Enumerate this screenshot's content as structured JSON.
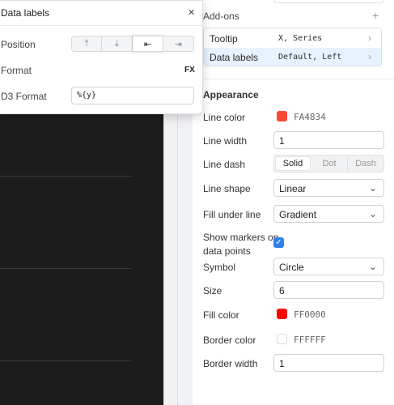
{
  "popup": {
    "title": "Data labels",
    "close_icon": "✕",
    "position_label": "Position",
    "position_options": [
      "⤒",
      "⤓",
      "⇤",
      "⇥"
    ],
    "format_label": "Format",
    "format_fx": "FX",
    "d3_label": "D3 Format",
    "d3_value": "%{y}"
  },
  "addons": {
    "title": "Add-ons",
    "add_icon": "+",
    "items": [
      {
        "label": "Tooltip",
        "value": "X, Series"
      },
      {
        "label": "Data labels",
        "value": "Default, Left"
      }
    ]
  },
  "appearance": {
    "title": "Appearance",
    "line_color": {
      "label": "Line color",
      "hex": "FA4834",
      "color": "#FA4834"
    },
    "line_width": {
      "label": "Line width",
      "value": "1"
    },
    "line_dash": {
      "label": "Line dash",
      "options": [
        "Solid",
        "Dot",
        "Dash"
      ]
    },
    "line_shape": {
      "label": "Line shape",
      "value": "Linear"
    },
    "fill_under": {
      "label": "Fill under line",
      "value": "Gradient"
    },
    "markers": {
      "label_line1": "Show markers on",
      "label_line2": "data points",
      "checked": true
    },
    "symbol": {
      "label": "Symbol",
      "value": "Circle"
    },
    "size": {
      "label": "Size",
      "value": "6"
    },
    "fill_color": {
      "label": "Fill color",
      "hex": "FF0000",
      "color": "#FF0000"
    },
    "border_color": {
      "label": "Border color",
      "hex": "FFFFFF",
      "color": "#FFFFFF"
    },
    "border_width": {
      "label": "Border width",
      "value": "1"
    }
  }
}
